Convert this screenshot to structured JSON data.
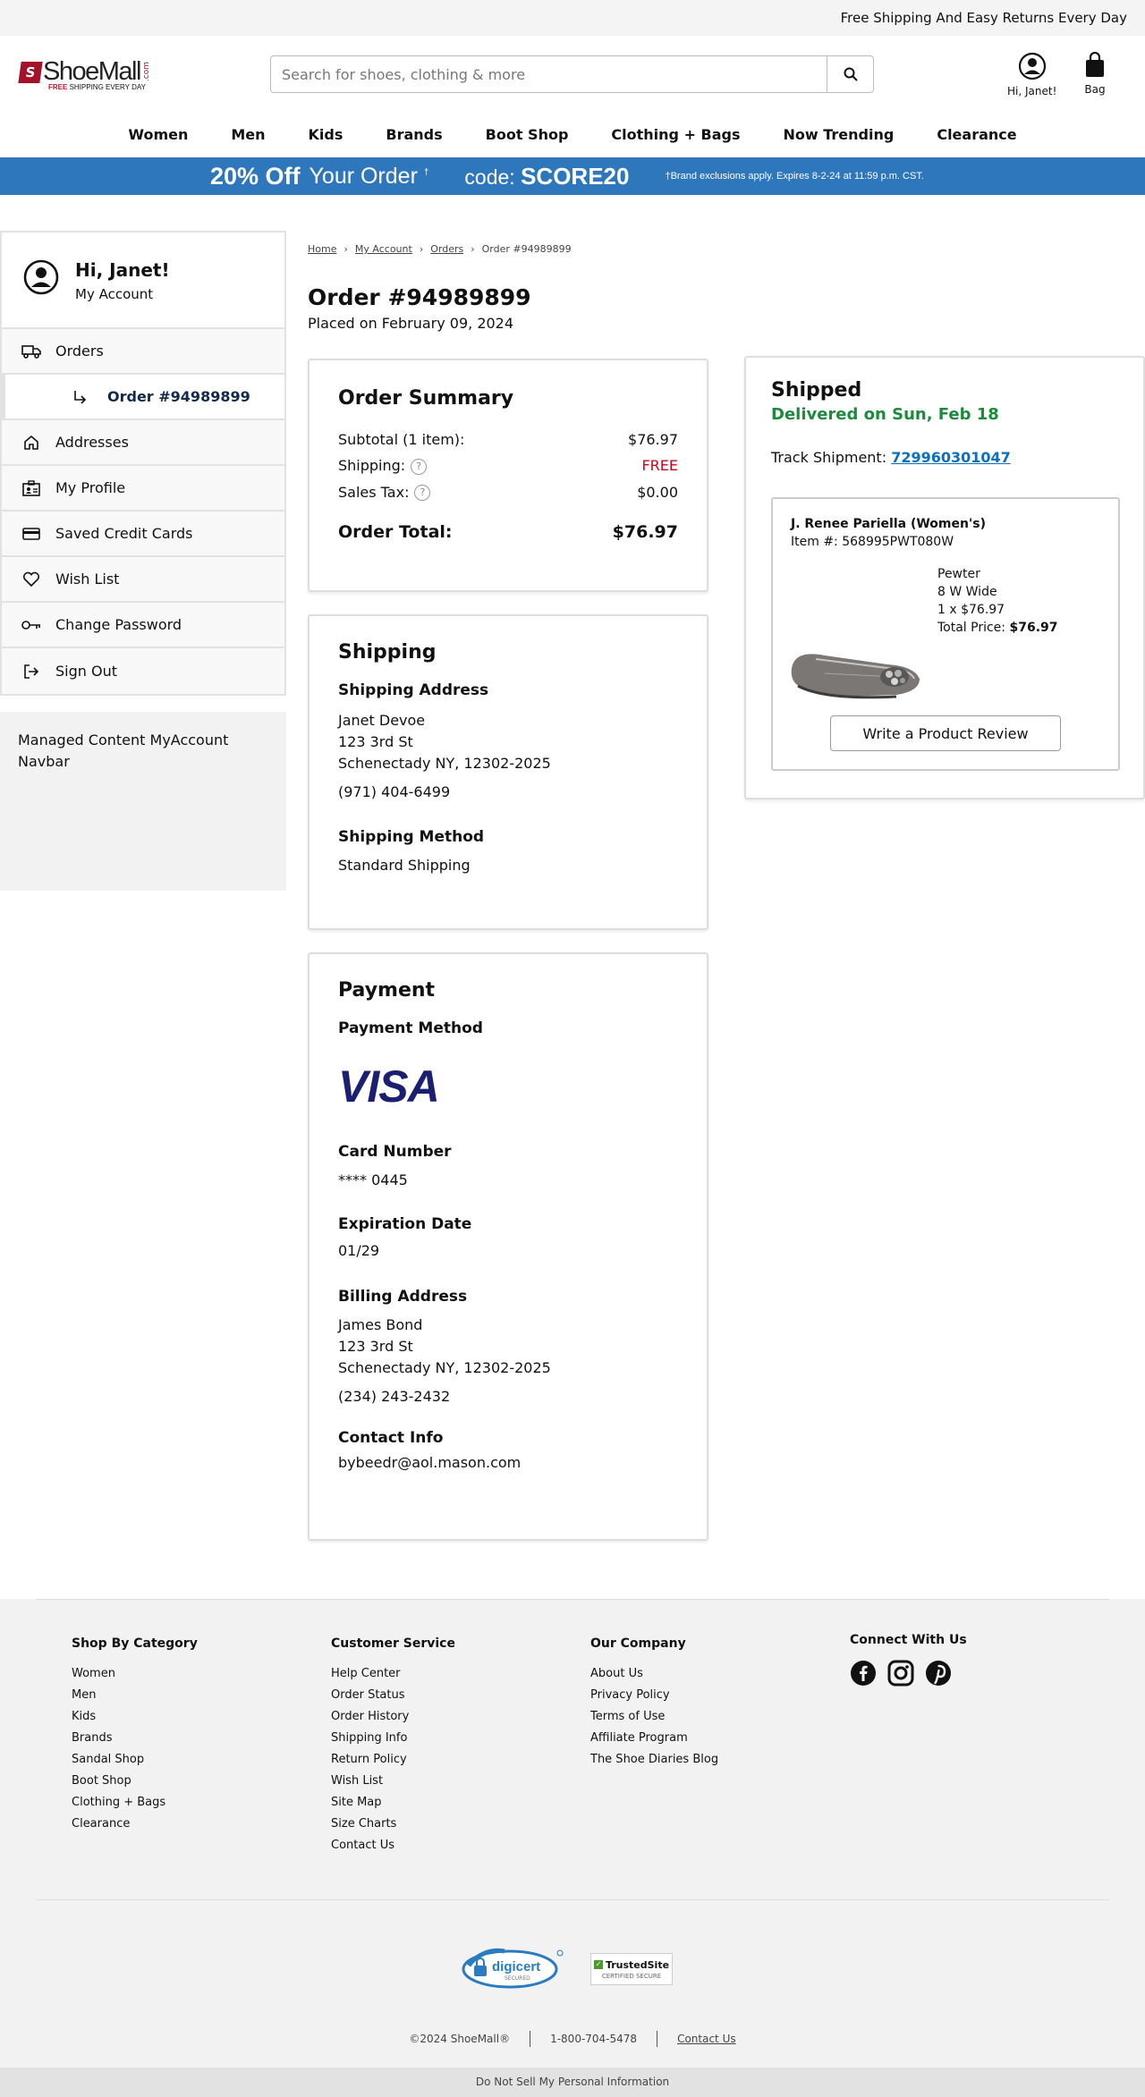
{
  "topbar": {
    "text": "Free Shipping And Easy Returns Every Day"
  },
  "logo": {
    "name": "ShoeMall",
    "com": ".com",
    "tag_red": "FREE",
    "tag_rest": " SHIPPING EVERY DAY"
  },
  "search": {
    "placeholder": "Search for shoes, clothing & more"
  },
  "header": {
    "account_label": "Hi, Janet!",
    "bag_label": "Bag"
  },
  "nav": [
    "Women",
    "Men",
    "Kids",
    "Brands",
    "Boot Shop",
    "Clothing + Bags",
    "Now Trending",
    "Clearance"
  ],
  "promo": {
    "big": "20% Off",
    "rest": "Your Order",
    "dagger": "†",
    "code_label": "code:",
    "code": "SCORE20",
    "fine": "†Brand exclusions apply. Expires 8-2-24 at 11:59 p.m. CST."
  },
  "sidebar": {
    "greeting": "Hi, Janet!",
    "my_account": "My Account",
    "items": [
      {
        "label": "Orders",
        "icon": "truck-icon"
      },
      {
        "label": "Order #94989899",
        "icon": "arrow-return-icon"
      },
      {
        "label": "Addresses",
        "icon": "home-icon"
      },
      {
        "label": "My Profile",
        "icon": "id-card-icon"
      },
      {
        "label": "Saved Credit Cards",
        "icon": "credit-card-icon"
      },
      {
        "label": "Wish List",
        "icon": "heart-icon"
      },
      {
        "label": "Change Password",
        "icon": "key-icon"
      },
      {
        "label": "Sign Out",
        "icon": "sign-out-icon"
      }
    ],
    "managed": "Managed Content MyAccount Navbar"
  },
  "breadcrumb": [
    "Home",
    "My Account",
    "Orders",
    "Order #94989899"
  ],
  "order": {
    "title": "Order #94989899",
    "placed": "Placed on February 09, 2024"
  },
  "summary": {
    "title": "Order Summary",
    "subtotal_label": "Subtotal (1 item):",
    "subtotal": "$76.97",
    "shipping_label": "Shipping:",
    "shipping": "FREE",
    "tax_label": "Sales Tax:",
    "tax": "$0.00",
    "total_label": "Order Total:",
    "total": "$76.97"
  },
  "shipping": {
    "title": "Shipping",
    "address_title": "Shipping Address",
    "name": "Janet Devoe",
    "street": "123 3rd St",
    "city": "Schenectady NY, 12302-2025",
    "phone": "(971) 404-6499",
    "method_title": "Shipping Method",
    "method": "Standard Shipping"
  },
  "payment": {
    "title": "Payment",
    "method_title": "Payment Method",
    "card_brand": "VISA",
    "card_number_title": "Card Number",
    "card_number": "**** 0445",
    "expiration_title": "Expiration Date",
    "expiration": "01/29",
    "billing_title": "Billing Address",
    "billing_name": "James Bond",
    "billing_street": "123 3rd St",
    "billing_city": "Schenectady NY, 12302-2025",
    "billing_phone": "(234) 243-2432",
    "contact_title": "Contact Info",
    "email": "bybeedr@aol.mason.com"
  },
  "shipment": {
    "status": "Shipped",
    "delivered": "Delivered on Sun, Feb 18",
    "track_label": "Track Shipment:",
    "tracking": "729960301047",
    "product": {
      "name": "J. Renee Pariella (Women's)",
      "item_no": "Item #: 568995PWT080W",
      "color": "Pewter",
      "size": "8 W Wide",
      "qty_price": "1 x $76.97",
      "total_label": "Total Price:",
      "total": "$76.97",
      "review_button": "Write a Product Review"
    }
  },
  "footer": {
    "col1": {
      "title": "Shop By Category",
      "links": [
        "Women",
        "Men",
        "Kids",
        "Brands",
        "Sandal Shop",
        "Boot Shop",
        "Clothing + Bags",
        "Clearance"
      ]
    },
    "col2": {
      "title": "Customer Service",
      "links": [
        "Help Center",
        "Order Status",
        "Order History",
        "Shipping Info",
        "Return Policy",
        "Wish List",
        "Site Map",
        "Size Charts",
        "Contact Us"
      ]
    },
    "col3": {
      "title": "Our Company",
      "links": [
        "About Us",
        "Privacy Policy",
        "Terms of Use",
        "Affiliate Program",
        "The Shoe Diaries Blog"
      ]
    },
    "col4": {
      "title": "Connect With Us",
      "icons": [
        "facebook-icon",
        "instagram-icon",
        "pinterest-icon"
      ]
    },
    "digicert": "digicert",
    "digicert_sub": "SECURED",
    "trusted": "TrustedSite",
    "trusted_sub": "CERTIFIED SECURE",
    "copyright": "©2024 ShoeMall®",
    "phone": "1-800-704-5478",
    "contact": "Contact Us",
    "do_not_sell": "Do Not Sell My Personal Information"
  },
  "colors": {
    "promo": "#2f77bd",
    "delivered": "#1e8a3c",
    "free": "#d0021b",
    "tracking": "#0b6fbf",
    "visa": "#1a1f71"
  }
}
